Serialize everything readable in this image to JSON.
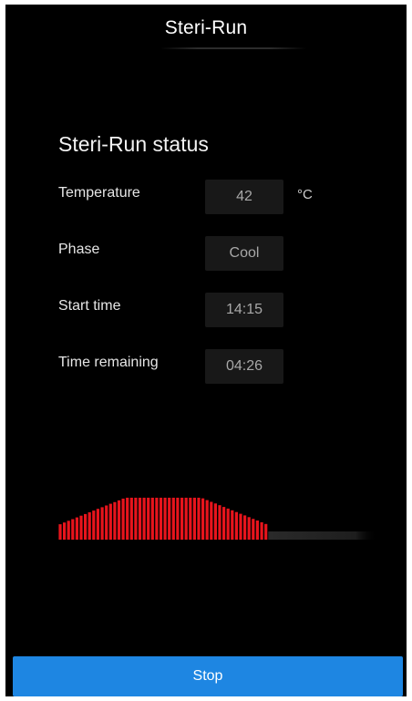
{
  "header": {
    "title": "Steri-Run"
  },
  "status": {
    "heading": "Steri-Run status",
    "rows": [
      {
        "label": "Temperature",
        "value": "42",
        "unit": "°C"
      },
      {
        "label": "Phase",
        "value": "Cool"
      },
      {
        "label": "Start time",
        "value": "14:15"
      },
      {
        "label": "Time remaining",
        "value": "04:26"
      }
    ]
  },
  "progress": {
    "fraction_elapsed": 0.66
  },
  "colors": {
    "progress_active": "#e8141c",
    "progress_track": "#1a1a1a",
    "stop_button": "#1e86e2"
  },
  "actions": {
    "stop_label": "Stop"
  }
}
